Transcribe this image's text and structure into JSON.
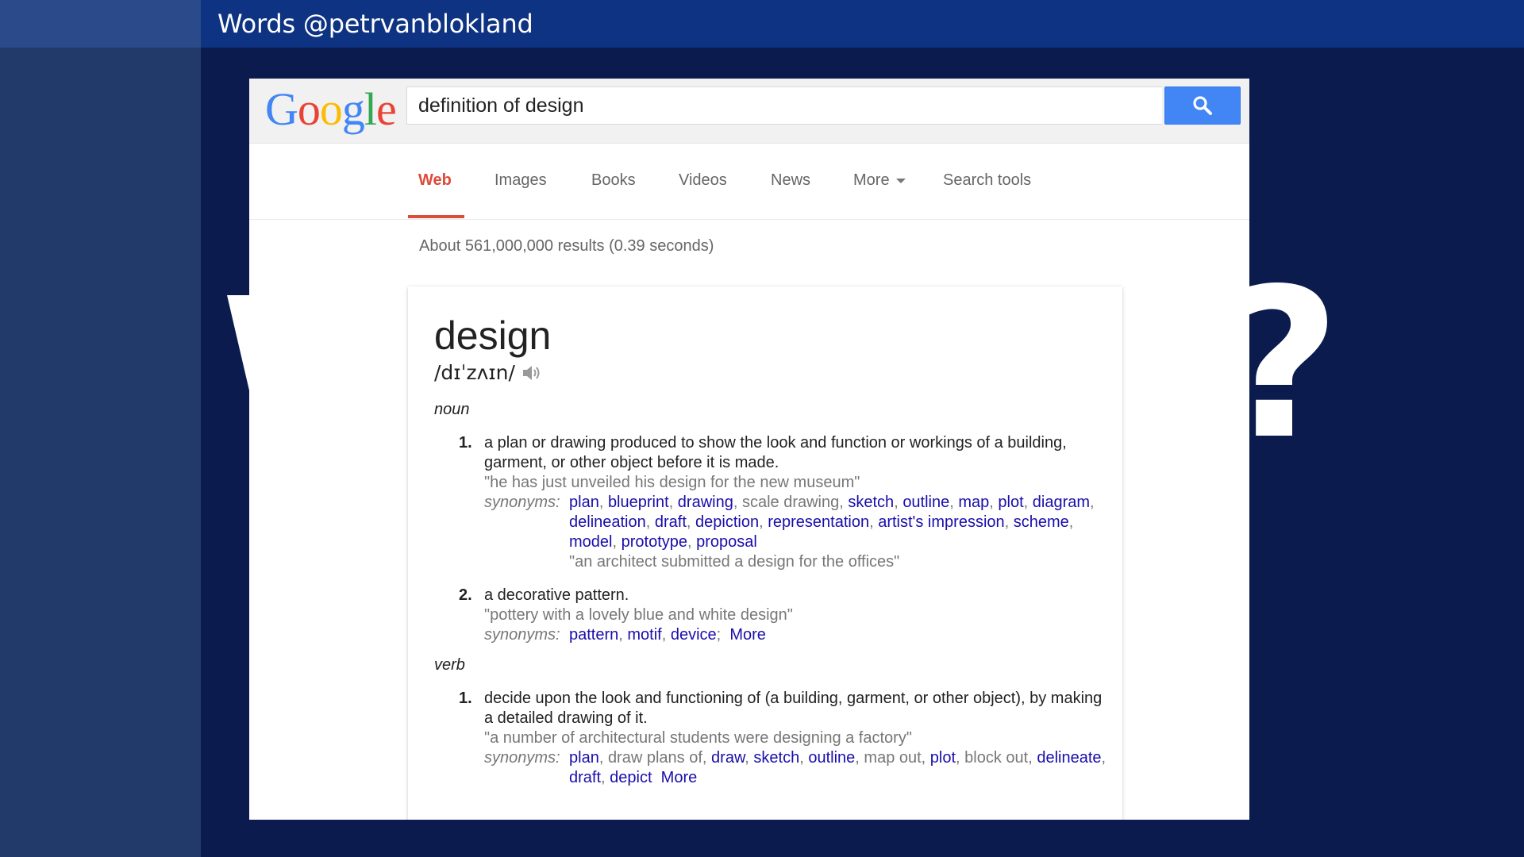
{
  "slide": {
    "title": "Words @petrvanblokland"
  },
  "google": {
    "logo": [
      "G",
      "o",
      "o",
      "g",
      "l",
      "e"
    ],
    "logo_colors": [
      "#4285f4",
      "#ea4335",
      "#fbbc05",
      "#4285f4",
      "#34a853",
      "#ea4335"
    ],
    "search_query": "definition of design",
    "search_icon": "magnifier-icon",
    "tabs": [
      "Web",
      "Images",
      "Books",
      "Videos",
      "News",
      "More",
      "Search tools"
    ],
    "result_stats": "About 561,000,000 results (0.39 seconds)"
  },
  "definition": {
    "word": "design",
    "phonetic": "/dɪˈzʌɪn/",
    "audio_icon": "speaker-icon",
    "noun_label": "noun",
    "verb_label": "verb",
    "synonyms_label": "synonyms:",
    "more_label": "More",
    "noun_defs": [
      {
        "num": "1.",
        "text": "a plan or drawing produced to show the look and function or workings of a building, garment, or other object before it is made.",
        "example": "\"he has just unveiled his design for the new museum\"",
        "synonyms": [
          "plan",
          "blueprint",
          "drawing",
          "scale drawing",
          "sketch",
          "outline",
          "map",
          "plot",
          "diagram",
          "delineation",
          "draft",
          "depiction",
          "representation",
          "artist's impression",
          "scheme",
          "model",
          "prototype",
          "proposal"
        ],
        "example2": "\"an architect submitted a design for the offices\""
      },
      {
        "num": "2.",
        "text": "a decorative pattern.",
        "example": "\"pottery with a lovely blue and white design\"",
        "synonyms": [
          "pattern",
          "motif",
          "device"
        ]
      }
    ],
    "verb_defs": [
      {
        "num": "1.",
        "text": "decide upon the look and functioning of (a building, garment, or other object), by making a detailed drawing of it.",
        "example": "\"a number of architectural students were designing a factory\"",
        "synonyms": [
          "plan",
          "draw plans of",
          "draw",
          "sketch",
          "outline",
          "map out",
          "plot",
          "block out",
          "delineate",
          "draft",
          "depict"
        ]
      }
    ]
  }
}
